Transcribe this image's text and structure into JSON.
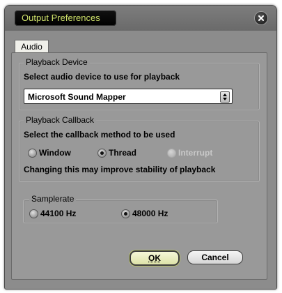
{
  "window": {
    "title": "Output Preferences",
    "close_icon": "close-icon"
  },
  "tabs": [
    {
      "label": "Audio"
    }
  ],
  "playback_device": {
    "legend": "Playback Device",
    "prompt": "Select audio device to use for playback",
    "selected": "Microsoft Sound Mapper"
  },
  "playback_callback": {
    "legend": "Playback Callback",
    "prompt": "Select the callback method to be used",
    "options": [
      {
        "label": "Window",
        "checked": false,
        "enabled": true
      },
      {
        "label": "Thread",
        "checked": true,
        "enabled": true
      },
      {
        "label": "Interrupt",
        "checked": false,
        "enabled": false
      }
    ],
    "note": "Changing this may improve stability of playback"
  },
  "samplerate": {
    "legend": "Samplerate",
    "options": [
      {
        "label": "44100 Hz",
        "checked": false
      },
      {
        "label": "48000 Hz",
        "checked": true
      }
    ]
  },
  "buttons": {
    "ok": "OK",
    "cancel": "Cancel"
  }
}
